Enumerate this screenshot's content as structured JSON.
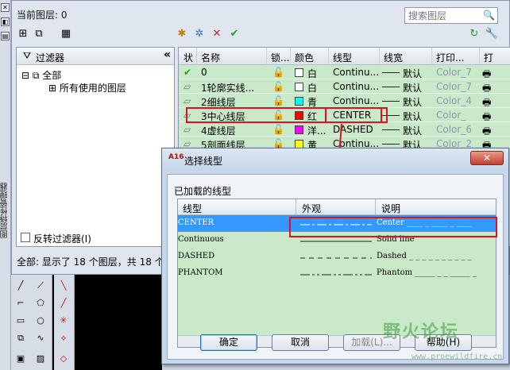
{
  "layer_manager": {
    "current_layer": "当前图层: 0",
    "search_placeholder": "搜索图层",
    "filter_header": "过滤器",
    "tree": {
      "all": "全部",
      "all_used": "所有使用的图层"
    },
    "invert_filter": "反转过滤器(I)",
    "status": "全部: 显示了 18 个图层，共 18 个",
    "side_label": "图层特性管理器",
    "columns": [
      "状",
      "名称",
      "锁...",
      "颜色",
      "线型",
      "线宽",
      "打印...",
      "打"
    ],
    "rows": [
      {
        "status": "✔",
        "name": "0",
        "color_name": "白",
        "color": "#ffffff",
        "linetype": "Continu...",
        "lineweight": "默认",
        "plot_style": "Color_7"
      },
      {
        "status": "▱",
        "name": "1轮廓实线...",
        "color_name": "白",
        "color": "#ffffff",
        "linetype": "Continu...",
        "lineweight": "默认",
        "plot_style": "Color_7"
      },
      {
        "status": "▱",
        "name": "2细线层",
        "color_name": "青",
        "color": "#00ffff",
        "linetype": "Continu...",
        "lineweight": "默认",
        "plot_style": "Color_4"
      },
      {
        "status": "▱",
        "name": "3中心线层",
        "color_name": "红",
        "color": "#ff0000",
        "linetype": "CENTER",
        "lineweight": "默认",
        "plot_style": "Color_"
      },
      {
        "status": "▱",
        "name": "4虚线层",
        "color_name": "洋...",
        "color": "#ff00ff",
        "linetype": "DASHED",
        "lineweight": "默认",
        "plot_style": "Color_6"
      },
      {
        "status": "▱",
        "name": "5剖面线层",
        "color_name": "黄",
        "color": "#ffff00",
        "linetype": "Continu...",
        "lineweight": "默认",
        "plot_style": "Color_2"
      }
    ]
  },
  "dialog": {
    "app_icon": "A16",
    "title": "选择线型",
    "loaded_label": "已加载的线型",
    "columns": {
      "linetype": "线型",
      "appearance": "外观",
      "description": "说明"
    },
    "rows": [
      {
        "name": "CENTER",
        "desc": "Center ____ _ ____ _ ____",
        "selected": true
      },
      {
        "name": "Continuous",
        "desc": "Solid line",
        "selected": false
      },
      {
        "name": "DASHED",
        "desc": "Dashed _ _ _ _ _ _ _ _ _ _",
        "selected": false
      },
      {
        "name": "PHANTOM",
        "desc": "Phantom _____ _ _ _____ _",
        "selected": false
      }
    ],
    "buttons": {
      "ok": "确定",
      "cancel": "取消",
      "load": "加载(L)...",
      "help": "帮助(H)"
    },
    "close": "✕"
  },
  "watermark": {
    "text": "野火论坛",
    "url": "www.proewildfire.cn"
  },
  "accent_color": "#e01020"
}
